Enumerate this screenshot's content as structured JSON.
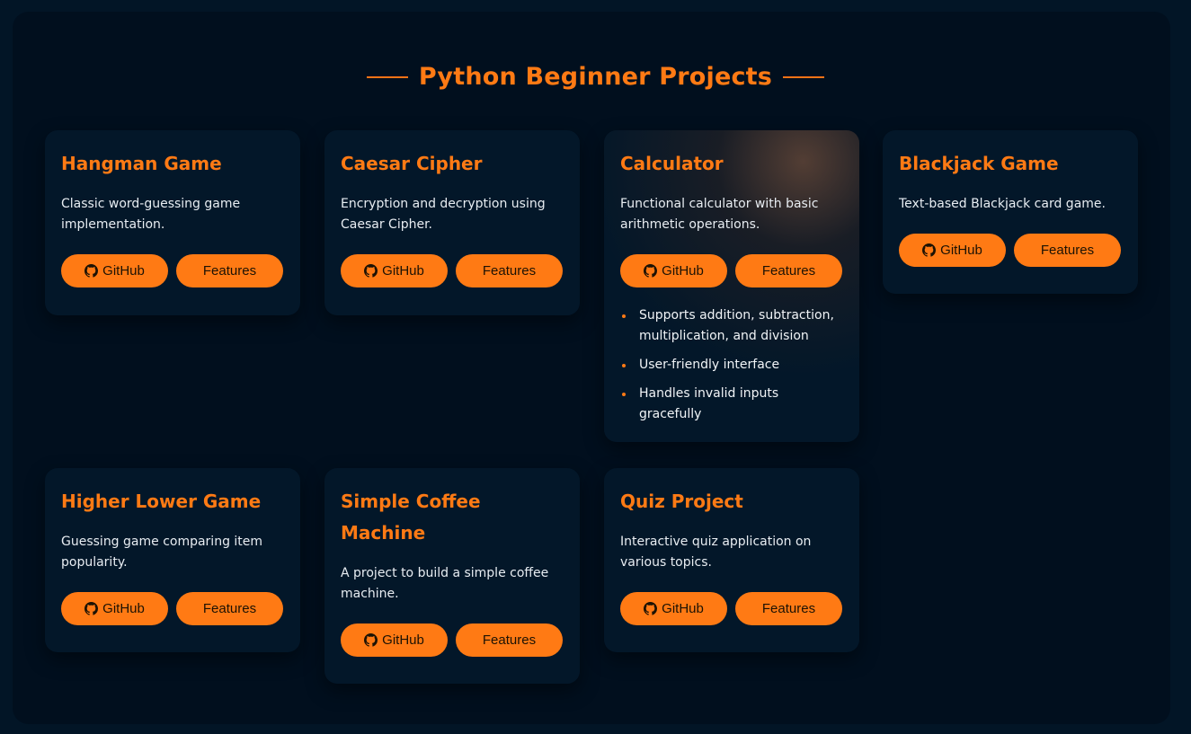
{
  "heading": "Python Beginner Projects",
  "buttons": {
    "github": "GitHub",
    "features": "Features"
  },
  "projects": [
    {
      "title": "Hangman Game",
      "description": "Classic word-guessing game implementation."
    },
    {
      "title": "Caesar Cipher",
      "description": "Encryption and decryption using Caesar Cipher."
    },
    {
      "title": "Calculator",
      "description": "Functional calculator with basic arithmetic operations.",
      "features": [
        "Supports addition, subtraction, multiplication, and division",
        "User-friendly interface",
        "Handles invalid inputs gracefully"
      ]
    },
    {
      "title": "Blackjack Game",
      "description": "Text-based Blackjack card game."
    },
    {
      "title": "Higher Lower Game",
      "description": "Guessing game comparing item popularity."
    },
    {
      "title": "Simple Coffee Machine",
      "description": "A project to build a simple coffee machine."
    },
    {
      "title": "Quiz Project",
      "description": "Interactive quiz application on various topics."
    }
  ],
  "colors": {
    "accent": "#ff7a14",
    "background": "#021526",
    "card": "#031729"
  },
  "icons": {
    "github": "github-icon"
  }
}
